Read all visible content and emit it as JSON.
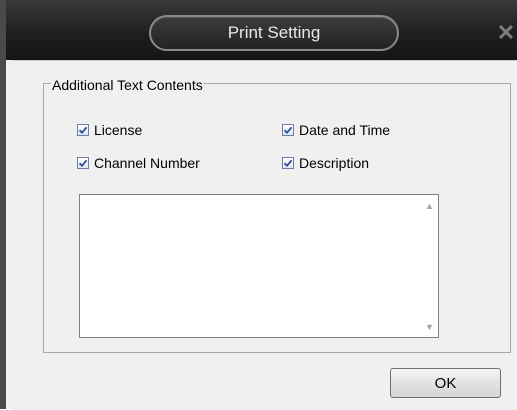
{
  "dialog": {
    "title": "Print Setting",
    "close_icon": "close-icon"
  },
  "group": {
    "legend": "Additional Text Contents",
    "options": [
      {
        "label": "License",
        "checked": true
      },
      {
        "label": "Date and Time",
        "checked": true
      },
      {
        "label": "Channel Number",
        "checked": true
      },
      {
        "label": "Description",
        "checked": true
      }
    ],
    "text_area_value": ""
  },
  "buttons": {
    "ok_label": "OK"
  }
}
